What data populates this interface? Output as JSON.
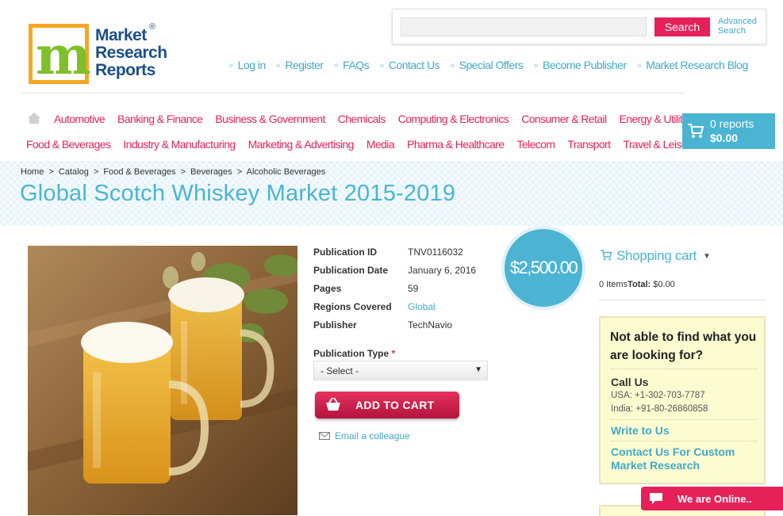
{
  "brand": {
    "logo_letter": "m",
    "name_lines": [
      "Market",
      "Research",
      "Reports"
    ],
    "registered_mark": "®"
  },
  "search": {
    "placeholder": "",
    "button_label": "Search",
    "advanced_label_line1": "Advanced",
    "advanced_label_line2": "Search"
  },
  "top_nav": [
    "Log in",
    "Register",
    "FAQs",
    "Contact Us",
    "Special Offers",
    "Become Publisher",
    "Market Research Blog"
  ],
  "categories": {
    "row1": [
      "Automotive",
      "Banking & Finance",
      "Business & Government",
      "Chemicals",
      "Computing & Electronics",
      "Consumer & Retail",
      "Energy & Utilities"
    ],
    "row2": [
      "Food & Beverages",
      "Industry & Manufacturing",
      "Marketing & Advertising",
      "Media",
      "Pharma & Healthcare",
      "Telecom",
      "Transport",
      "Travel & Leisure"
    ]
  },
  "mini_cart": {
    "count": "0 reports",
    "total": "$0.00"
  },
  "breadcrumb": [
    "Home",
    "Catalog",
    "Food & Beverages",
    "Beverages",
    "Alcoholic Beverages"
  ],
  "breadcrumb_sep": ">",
  "page_title": "Global Scotch Whiskey Market 2015-2019",
  "product": {
    "price": "$2,500.00",
    "details": [
      {
        "label": "Publication ID",
        "value": "TNV0116032"
      },
      {
        "label": "Publication Date",
        "value": "January 6, 2016"
      },
      {
        "label": "Pages",
        "value": "59"
      },
      {
        "label": "Regions Covered",
        "value": "Global"
      },
      {
        "label": "Publisher",
        "value": "TechNavio"
      }
    ],
    "publication_type_label": "Publication Type",
    "required_mark": "*",
    "select_value": "- Select -",
    "add_to_cart": "ADD TO CART",
    "email_colleague": "Email a colleague"
  },
  "sidebar": {
    "cart_title": "Shopping cart",
    "items_label": "0 Items",
    "total_label": "Total:",
    "total_value": "$0.00",
    "help_title": "Not able to find what you are looking for?",
    "call_us": "Call Us",
    "phone_usa": "USA: +1-302-703-7787",
    "phone_india": "India: +91-80-26860858",
    "write_to_us": "Write to Us",
    "custom_research": "Contact Us For Custom Market Research"
  },
  "chat": {
    "label": "We are Online.."
  },
  "colors": {
    "accent_pink": "#e6215a",
    "accent_blue": "#4bb4d2",
    "link_blue": "#3fa9c8",
    "logo_orange": "#f5a623"
  },
  "icons": [
    "home-icon",
    "cart-icon",
    "mail-icon",
    "chat-bubble-icon",
    "caret-down-icon"
  ]
}
